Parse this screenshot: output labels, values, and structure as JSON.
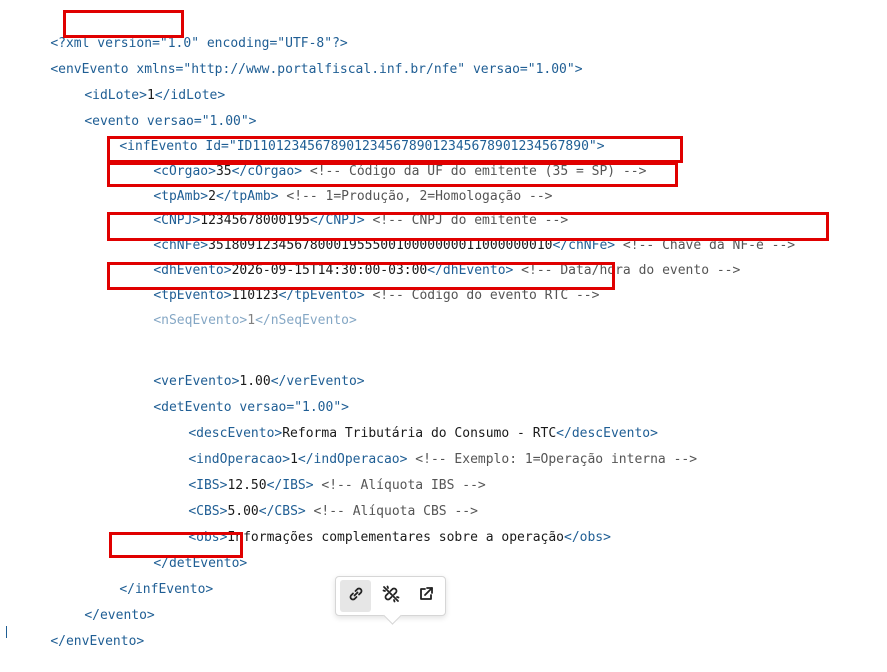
{
  "colors": {
    "tag": "#1f5e94",
    "attribute": "#1f5e94",
    "comment": "#555555",
    "highlight": "#e00000"
  },
  "code": {
    "xml_decl_open": "<?xml ",
    "xml_version": "version=\"1.0\"",
    "xml_encoding": " encoding=\"UTF-8\"?>",
    "envEvento_open": "<envEvento xmlns=\"http://www.portalfiscal.inf.br/nfe\" versao=\"1.00\">",
    "idLote_open": "<idLote>",
    "idLote_value": "1",
    "idLote_close": "</idLote>",
    "evento_open": "<evento versao=\"1.00\">",
    "infEvento_open": "<infEvento Id=\"ID1101234567890123456789012345678901234567890\">",
    "cOrgao_open": "<cOrgao>",
    "cOrgao_value": "35",
    "cOrgao_close": "</cOrgao>",
    "cOrgao_comment": " <!-- Código da UF do emitente (35 = SP) -->",
    "tpAmb_open": "<tpAmb>",
    "tpAmb_value": "2",
    "tpAmb_close": "</tpAmb>",
    "tpAmb_comment": " <!-- 1=Produção, 2=Homologação -->",
    "CNPJ_open": "<CNPJ>",
    "CNPJ_value": "12345678000195",
    "CNPJ_close": "</CNPJ>",
    "CNPJ_comment": " <!-- CNPJ do emitente -->",
    "chNFe_open": "<chNFe>",
    "chNFe_value": "35180912345678000195550010000000011000000010",
    "chNFe_close": "</chNFe>",
    "chNFe_comment": " <!-- Chave da NF-e -->",
    "dhEvento_open": "<dhEvento>",
    "dhEvento_value": "2026-09-15T14:30:00-03:00",
    "dhEvento_close": "</dhEvento>",
    "dhEvento_comment": " <!-- Data/hora do evento -->",
    "tpEvento_open": "<tpEvento>",
    "tpEvento_value": "110123",
    "tpEvento_close": "</tpEvento>",
    "tpEvento_comment": " <!-- Código do evento RTC -->",
    "nSeqEvento_open": "<nSeqEvento>",
    "nSeqEvento_value": "1",
    "nSeqEvento_close": "</nSeqEvento>",
    "verEvento_open": "<verEvento>",
    "verEvento_value": "1.00",
    "verEvento_close": "</verEvento>",
    "detEvento_open": "<detEvento versao=\"1.00\">",
    "descEvento_open": "<descEvento>",
    "descEvento_value": "Reforma Tributária do Consumo - RTC",
    "descEvento_close": "</descEvento>",
    "indOperacao_open": "<indOperacao>",
    "indOperacao_value": "1",
    "indOperacao_close": "</indOperacao>",
    "indOperacao_comment": " <!-- Exemplo: 1=Operação interna -->",
    "IBS_open": "<IBS>",
    "IBS_value": "12.50",
    "IBS_close": "</IBS>",
    "IBS_comment": " <!-- Alíquota IBS -->",
    "CBS_open": "<CBS>",
    "CBS_value": "5.00",
    "CBS_close": "</CBS>",
    "CBS_comment": " <!-- Alíquota CBS -->",
    "obs_open": "<obs>",
    "obs_value": "Informações complementares sobre a operação",
    "obs_close": "</obs>",
    "detEvento_close": "</detEvento>",
    "infEvento_close": "</infEvento>",
    "evento_close": "</evento>",
    "envEvento_close": "</envEvento>"
  },
  "toolbar": {
    "edit_link_icon": "link-icon",
    "unlink_icon": "unlink-icon",
    "open_link_icon": "external-link-icon"
  }
}
